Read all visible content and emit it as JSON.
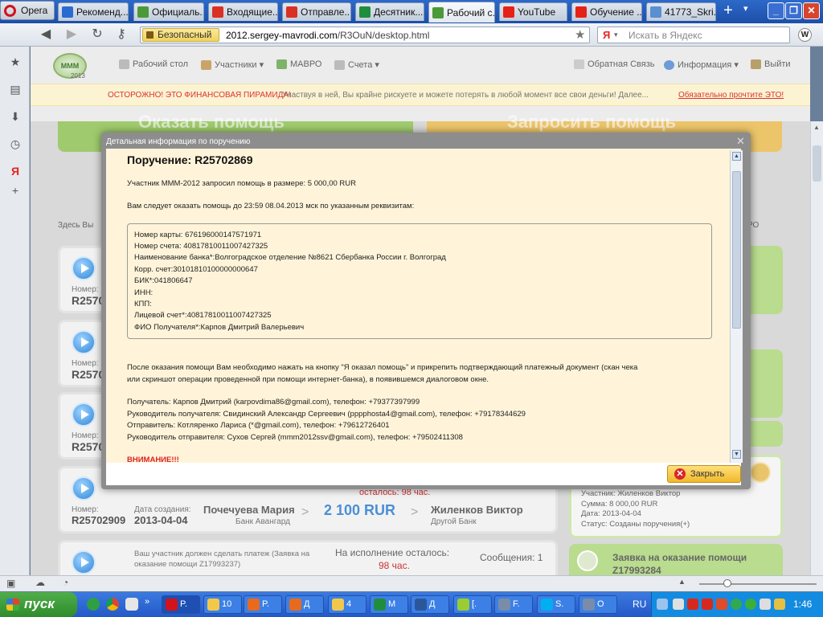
{
  "browser": {
    "opera_label": "Opera",
    "tabs": [
      {
        "label": "Рекоменд...",
        "icon": "document-icon",
        "color": "#2a6bd1"
      },
      {
        "label": "Официаль...",
        "icon": "mmm-icon",
        "color": "#4a9a3a"
      },
      {
        "label": "Входящие...",
        "icon": "gmail-icon",
        "color": "#d93025"
      },
      {
        "label": "Отправле...",
        "icon": "gmail-icon",
        "color": "#d93025"
      },
      {
        "label": "Десятник...",
        "icon": "spreadsheet-icon",
        "color": "#1e8e3e"
      },
      {
        "label": "Рабочий с...",
        "icon": "mmm-icon",
        "color": "#4a9a3a"
      },
      {
        "label": "YouTube",
        "icon": "youtube-icon",
        "color": "#e62117"
      },
      {
        "label": "Обучение ...",
        "icon": "youtube-icon",
        "color": "#e62117"
      },
      {
        "label": "41773_Skri...",
        "icon": "image-icon",
        "color": "#5a8fd0"
      }
    ],
    "new_tab": "+",
    "secure_label": "Безопасный",
    "url_host": "2012.sergey-mavrodi.com",
    "url_path": "/R3OuN/desktop.html",
    "search_engine": "Я",
    "search_placeholder": "Искать в Яндекс"
  },
  "site": {
    "logo_text": "MMM",
    "logo_year": "2013",
    "nav": [
      {
        "label": "Рабочий стол",
        "icon": "desktop-icon"
      },
      {
        "label": "Участники ▾",
        "icon": "users-icon"
      },
      {
        "label": "МАВРО",
        "icon": "mavro-icon"
      },
      {
        "label": "Счета ▾",
        "icon": "accounts-icon"
      }
    ],
    "nav_right": [
      {
        "label": "Обратная Связь",
        "icon": "feedback-icon"
      },
      {
        "label": "Информация ▾",
        "icon": "info-icon"
      },
      {
        "label": "Выйти",
        "icon": "exit-icon"
      }
    ],
    "warning_red": "ОСТОРОЖНО! ЭТО ФИНАНСОВАЯ ПИРАМИДА!",
    "warning_text": "Участвуя в ней, Вы крайне рискуете и можете потерять в любой момент все свои деньги! Далее...",
    "warning_link": "Обязательно прочтите ЭТО!",
    "big_left": "Оказать помощь",
    "big_right": "Запросить помощь",
    "here_label": "Здесь Вы",
    "ro_label": "РО",
    "cards": [
      {
        "num_label": "Номер:",
        "num": "R2570"
      },
      {
        "num_label": "Номер:",
        "num": "R2570"
      },
      {
        "num_label": "Номер:",
        "num": "R2570"
      },
      {
        "num_label": "Номер:",
        "num": "R25702909",
        "date_label": "Дата создания:",
        "date": "2013-04-04",
        "from": "Почечуева Мария",
        "from_bank": "Банк Авангард",
        "amount": "2 100 RUR",
        "to": "Жиленков Виктор",
        "to_bank": "Другой Банк",
        "remain": "осталось: 98 час."
      },
      {
        "text": "Ваш участник должен сделать платеж (Заявка на оказание помощи Z17993237)",
        "remain_label": "На исполнение осталось:",
        "remain": "98 час.",
        "messages": "Сообщения: 1"
      }
    ],
    "right_card": {
      "participant": "Участник: Жиленков Виктор",
      "sum": "Сумма: 8 000,00 RUR",
      "date": "Дата: 2013-04-04",
      "status": "Статус: Созданы поручения(+)"
    },
    "right_card2": {
      "title": "Заявка на оказание помощи",
      "num": "Z17993284"
    }
  },
  "modal": {
    "title": "Детальная информация по поручению",
    "heading": "Поручение: R25702869",
    "line1": "Участник МММ-2012 запросил помощь в размере: 5 000,00 RUR",
    "line2": "Вам следует оказать помощь до 23:59 08.04.2013 мск по указанным реквизитам:",
    "requisites": [
      "Номер карты: 676196000147571971",
      "Номер счета: 40817810011007427325",
      "Наименование банка*:Волгоградское отделение №8621 Сбербанка России г. Волгоград",
      "Корр. счет:30101810100000000647",
      "БИК*:041806647",
      "ИНН:",
      "КПП:",
      "Лицевой счет*:40817810011007427325",
      "ФИО Получателя*:Карпов Дмитрий Валерьевич"
    ],
    "after1": "После оказания помощи Вам необходимо нажать на кнопку \"Я оказал помощь\" и прикрепить подтверждающий платежный документ (скан чека",
    "after2": "или скриншот операции проведенной при помощи интернет-банка), в появившемся диалоговом окне.",
    "contacts": [
      "Получатель: Карпов Дмитрий (karpovdima86@gmail.com), телефон: +79377397999",
      "Руководитель получателя: Свидинский Александр Сергеевич (pppphosta4@gmail.com), телефон: +79178344629",
      "Отправитель: Котляренко Лариса (*@gmail.com), телефон: +79612726401",
      "Руководитель отправителя: Сухов Сергей (mmm2012ssv@gmail.com), телефон: +79502411308"
    ],
    "attention": "ВНИМАНИЕ!!!",
    "close_label": "Закрыть"
  },
  "taskbar": {
    "start_label": "пуск",
    "items": [
      {
        "label": "P.",
        "icon": "opera-icon",
        "color": "#d1131c"
      },
      {
        "label": "10",
        "icon": "folder-icon",
        "color": "#f2c84b"
      },
      {
        "label": "P.",
        "icon": "firefox-icon",
        "color": "#e86a1c"
      },
      {
        "label": "Д",
        "icon": "firefox-icon",
        "color": "#e86a1c"
      },
      {
        "label": "4",
        "icon": "folder-icon",
        "color": "#f2c84b"
      },
      {
        "label": "M",
        "icon": "excel-icon",
        "color": "#1e8e3e"
      },
      {
        "label": "Д",
        "icon": "word-icon",
        "color": "#2b579a"
      },
      {
        "label": "[.",
        "icon": "notepad-icon",
        "color": "#9acd32"
      },
      {
        "label": "F.",
        "icon": "app-icon",
        "color": "#7a8ca8"
      },
      {
        "label": "S.",
        "icon": "skype-icon",
        "color": "#00aff0"
      },
      {
        "label": "O",
        "icon": "app-icon",
        "color": "#7a8ca8"
      }
    ],
    "lang": "RU",
    "clock": "1:46"
  }
}
